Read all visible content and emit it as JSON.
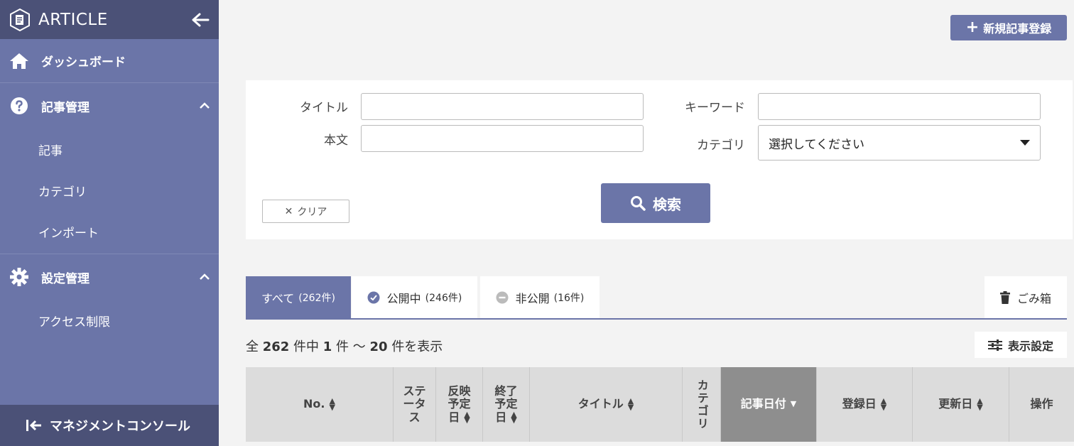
{
  "sidebar": {
    "title": "ARTICLE",
    "items": [
      {
        "label": "ダッシュボード",
        "icon": "home-icon"
      },
      {
        "label": "記事管理",
        "icon": "question-circle-icon",
        "subitems": [
          "記事",
          "カテゴリ",
          "インポート"
        ]
      },
      {
        "label": "設定管理",
        "icon": "gear-icon",
        "subitems": [
          "アクセス制限"
        ]
      }
    ],
    "footer_label": "マネジメントコンソール"
  },
  "header": {
    "new_button_label": "新規記事登録"
  },
  "search": {
    "title_label": "タイトル",
    "body_label": "本文",
    "keyword_label": "キーワード",
    "category_label": "カテゴリ",
    "category_value": "選択してください",
    "title_value": "",
    "body_value": "",
    "keyword_value": "",
    "clear_label": "クリア",
    "search_label": "検索"
  },
  "tabs": [
    {
      "label": "すべて",
      "count": "(262件)"
    },
    {
      "label": "公開中",
      "count": "(246件)"
    },
    {
      "label": "非公開",
      "count": "(16件)"
    }
  ],
  "trash_label": "ごみ箱",
  "results": {
    "prefix": "全",
    "total": "262",
    "middle": "件中",
    "from": "1",
    "sep": "件 〜",
    "to": "20",
    "suffix": "件を表示"
  },
  "display_settings_label": "表示設定",
  "table": {
    "columns": [
      {
        "label": "No."
      },
      {
        "label": "ステータス"
      },
      {
        "label": "反映予定日"
      },
      {
        "label": "終了予定日"
      },
      {
        "label": "タイトル"
      },
      {
        "label": "カテゴリ"
      },
      {
        "label": "記事日付"
      },
      {
        "label": "登録日"
      },
      {
        "label": "更新日"
      },
      {
        "label": "操作"
      }
    ]
  },
  "colors": {
    "accent": "#6b75a8",
    "sidebar_dark": "#4b5177",
    "active_sort_column": "#8e8e8e"
  }
}
